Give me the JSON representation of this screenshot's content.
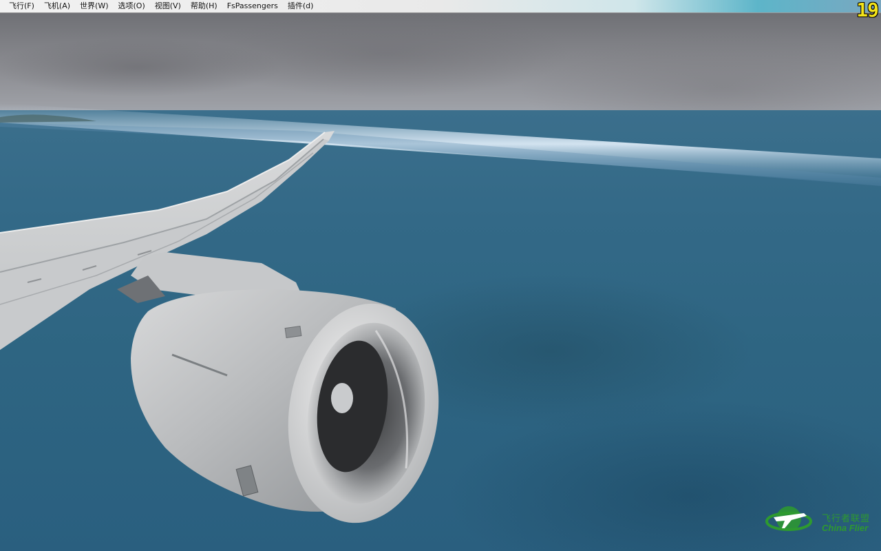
{
  "menu": {
    "items": [
      {
        "label": "飞行(F)"
      },
      {
        "label": "飞机(A)"
      },
      {
        "label": "世界(W)"
      },
      {
        "label": "选项(O)"
      },
      {
        "label": "视图(V)"
      },
      {
        "label": "帮助(H)"
      },
      {
        "label": "FsPassengers"
      },
      {
        "label": "插件(d)"
      }
    ]
  },
  "fps_counter": "19",
  "watermark": {
    "chinese_text": "飞行者联盟",
    "english_text": "China Flier",
    "logo_icon": "airplane-globe-logo"
  },
  "colors": {
    "fps_text": "#f4e41a",
    "watermark_green": "#2e9a2f",
    "sea": "#2e6582",
    "sky": "#8c8d92"
  }
}
